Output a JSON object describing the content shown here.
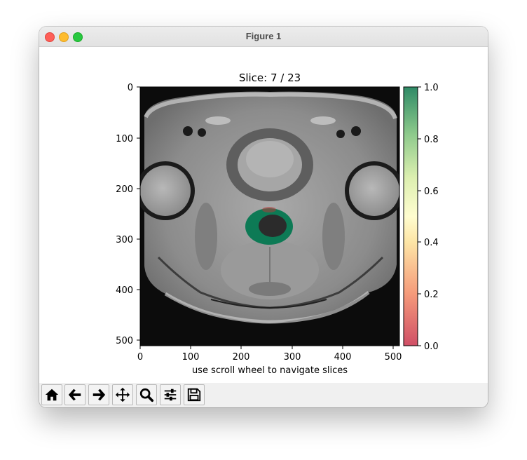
{
  "window": {
    "title": "Figure 1"
  },
  "plot": {
    "title": "Slice: 7 / 23",
    "xlabel": "use scroll wheel to navigate slices",
    "x_ticks": [
      "0",
      "100",
      "200",
      "300",
      "400",
      "500"
    ],
    "y_ticks": [
      "0",
      "100",
      "200",
      "300",
      "400",
      "500"
    ],
    "colorbar_ticks": [
      "1.0",
      "0.8",
      "0.6",
      "0.4",
      "0.2",
      "0.0"
    ]
  },
  "chart_data": {
    "type": "heatmap",
    "title": "Slice: 7 / 23",
    "xlabel": "use scroll wheel to navigate slices",
    "ylabel": "",
    "xlim": [
      0,
      512
    ],
    "ylim": [
      512,
      0
    ],
    "slice_current": 7,
    "slice_total": 23,
    "colorbar": {
      "range": [
        0.0,
        1.0
      ],
      "ticks": [
        0.0,
        0.2,
        0.4,
        0.6,
        0.8,
        1.0
      ],
      "colormap": "RdYlGn",
      "low_color": "#d04f66",
      "mid_color": "#fffdcf",
      "high_color": "#2f8a66"
    },
    "overlay": {
      "label": "segmentation mask",
      "value": 1.0,
      "color": "#0d7a55"
    }
  },
  "toolbar": {
    "buttons": [
      {
        "name": "home-icon"
      },
      {
        "name": "back-arrow-icon"
      },
      {
        "name": "forward-arrow-icon"
      },
      {
        "name": "pan-icon"
      },
      {
        "name": "zoom-icon"
      },
      {
        "name": "configure-subplots-icon"
      },
      {
        "name": "save-icon"
      }
    ]
  }
}
